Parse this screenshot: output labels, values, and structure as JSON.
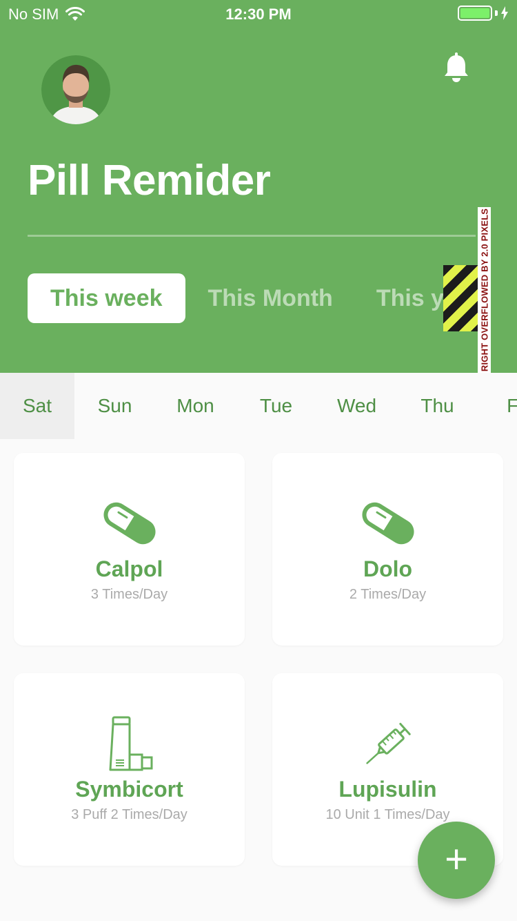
{
  "status_bar": {
    "carrier": "No SIM",
    "time": "12:30 PM",
    "battery_percent": 100
  },
  "header": {
    "title": "Pill Remider",
    "tabs": [
      {
        "label": "This week",
        "active": true
      },
      {
        "label": "This Month",
        "active": false
      },
      {
        "label": "This year",
        "active": false
      }
    ],
    "overflow_warning": "RIGHT OVERFLOWED BY 2.0 PIXELS"
  },
  "days": [
    {
      "label": "Sat",
      "active": true
    },
    {
      "label": "Sun"
    },
    {
      "label": "Mon"
    },
    {
      "label": "Tue"
    },
    {
      "label": "Wed"
    },
    {
      "label": "Thu"
    },
    {
      "label": "Fri"
    }
  ],
  "medicines": [
    {
      "name": "Calpol",
      "dosage": "3 Times/Day",
      "icon": "pill-icon"
    },
    {
      "name": "Dolo",
      "dosage": "2 Times/Day",
      "icon": "pill-icon"
    },
    {
      "name": "Symbicort",
      "dosage": "3 Puff 2 Times/Day",
      "icon": "inhaler-icon"
    },
    {
      "name": "Lupisulin",
      "dosage": "10 Unit 1 Times/Day",
      "icon": "syringe-icon"
    }
  ],
  "fab": {
    "label": "+"
  },
  "colors": {
    "primary": "#6ab05e",
    "primary_dark": "#4e8f45",
    "background": "#fafafa"
  }
}
